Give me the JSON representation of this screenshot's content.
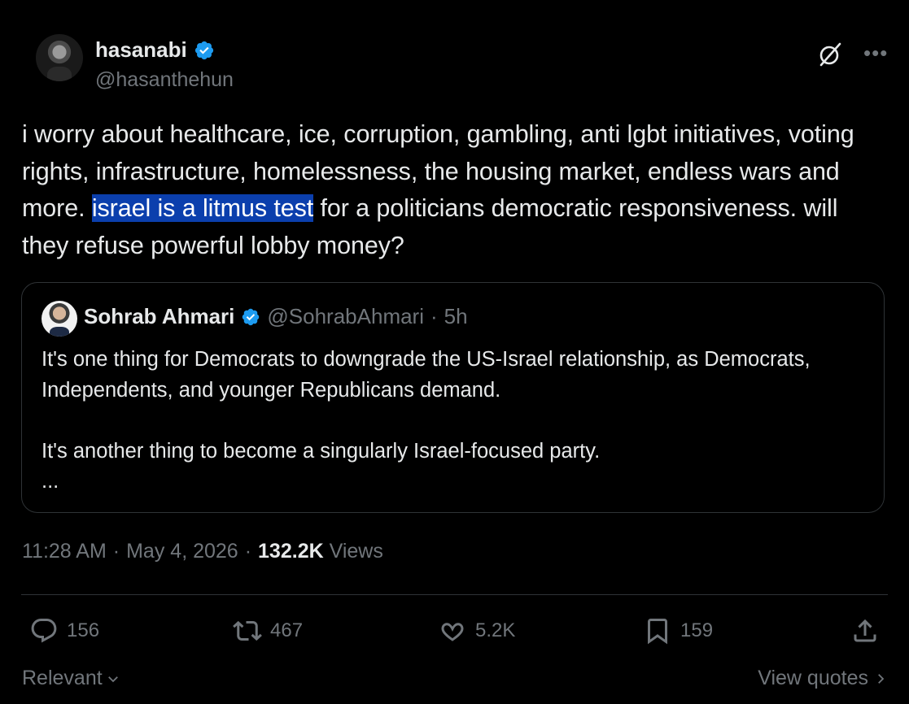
{
  "author": {
    "name": "hasanabi",
    "handle": "@hasanthehun"
  },
  "tweet": {
    "text_before": "i worry about healthcare, ice, corruption, gambling, anti lgbt initiatives, voting rights, infrastructure, homelessness, the housing market, endless wars and more. ",
    "text_highlight": "israel is a litmus test",
    "text_after": " for a politicians democratic responsiveness. will they refuse powerful lobby money?"
  },
  "quote": {
    "name": "Sohrab Ahmari",
    "handle": "@SohrabAhmari",
    "dot": "·",
    "time": "5h",
    "para1": "It's one thing for Democrats to downgrade the US-Israel relationship, as Democrats, Independents, and younger Republicans demand.",
    "para2": "It's another thing to become a singularly Israel-focused party.",
    "ellipsis": "..."
  },
  "meta": {
    "time": "11:28 AM",
    "sep1": "·",
    "date": "May 4, 2026",
    "sep2": "·",
    "views_count": "132.2K",
    "views_label": "Views"
  },
  "actions": {
    "replies": "156",
    "reposts": "467",
    "likes": "5.2K",
    "bookmarks": "159"
  },
  "footer": {
    "sort_label": "Relevant",
    "view_quotes": "View quotes"
  },
  "icons": {
    "verified": "verified-badge-icon",
    "grok": "grok-icon",
    "more": "more-icon",
    "reply": "reply-icon",
    "repost": "repost-icon",
    "like": "heart-icon",
    "bookmark": "bookmark-icon",
    "share": "share-icon"
  },
  "colors": {
    "background": "#000000",
    "text": "#e7e9ea",
    "muted": "#71767b",
    "verified": "#1d9bf0",
    "highlight": "#0b3fad",
    "border": "#2f3336"
  }
}
